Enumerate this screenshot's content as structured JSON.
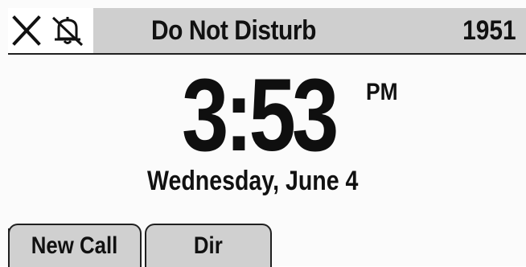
{
  "status_bar": {
    "icons": [
      "close-x-icon",
      "bell-muted-icon"
    ],
    "title": "Do Not Disturb",
    "extension": "1951"
  },
  "clock": {
    "time": "3:53",
    "meridiem": "PM",
    "date": "Wednesday, June 4"
  },
  "softkeys": [
    {
      "label": "New Call"
    },
    {
      "label": "Dir"
    }
  ],
  "colors": {
    "status_bar_bg": "#cfcfcf",
    "softkey_bg": "#d0d0d0",
    "screen_bg": "#fbfbfb",
    "text": "#111111"
  }
}
